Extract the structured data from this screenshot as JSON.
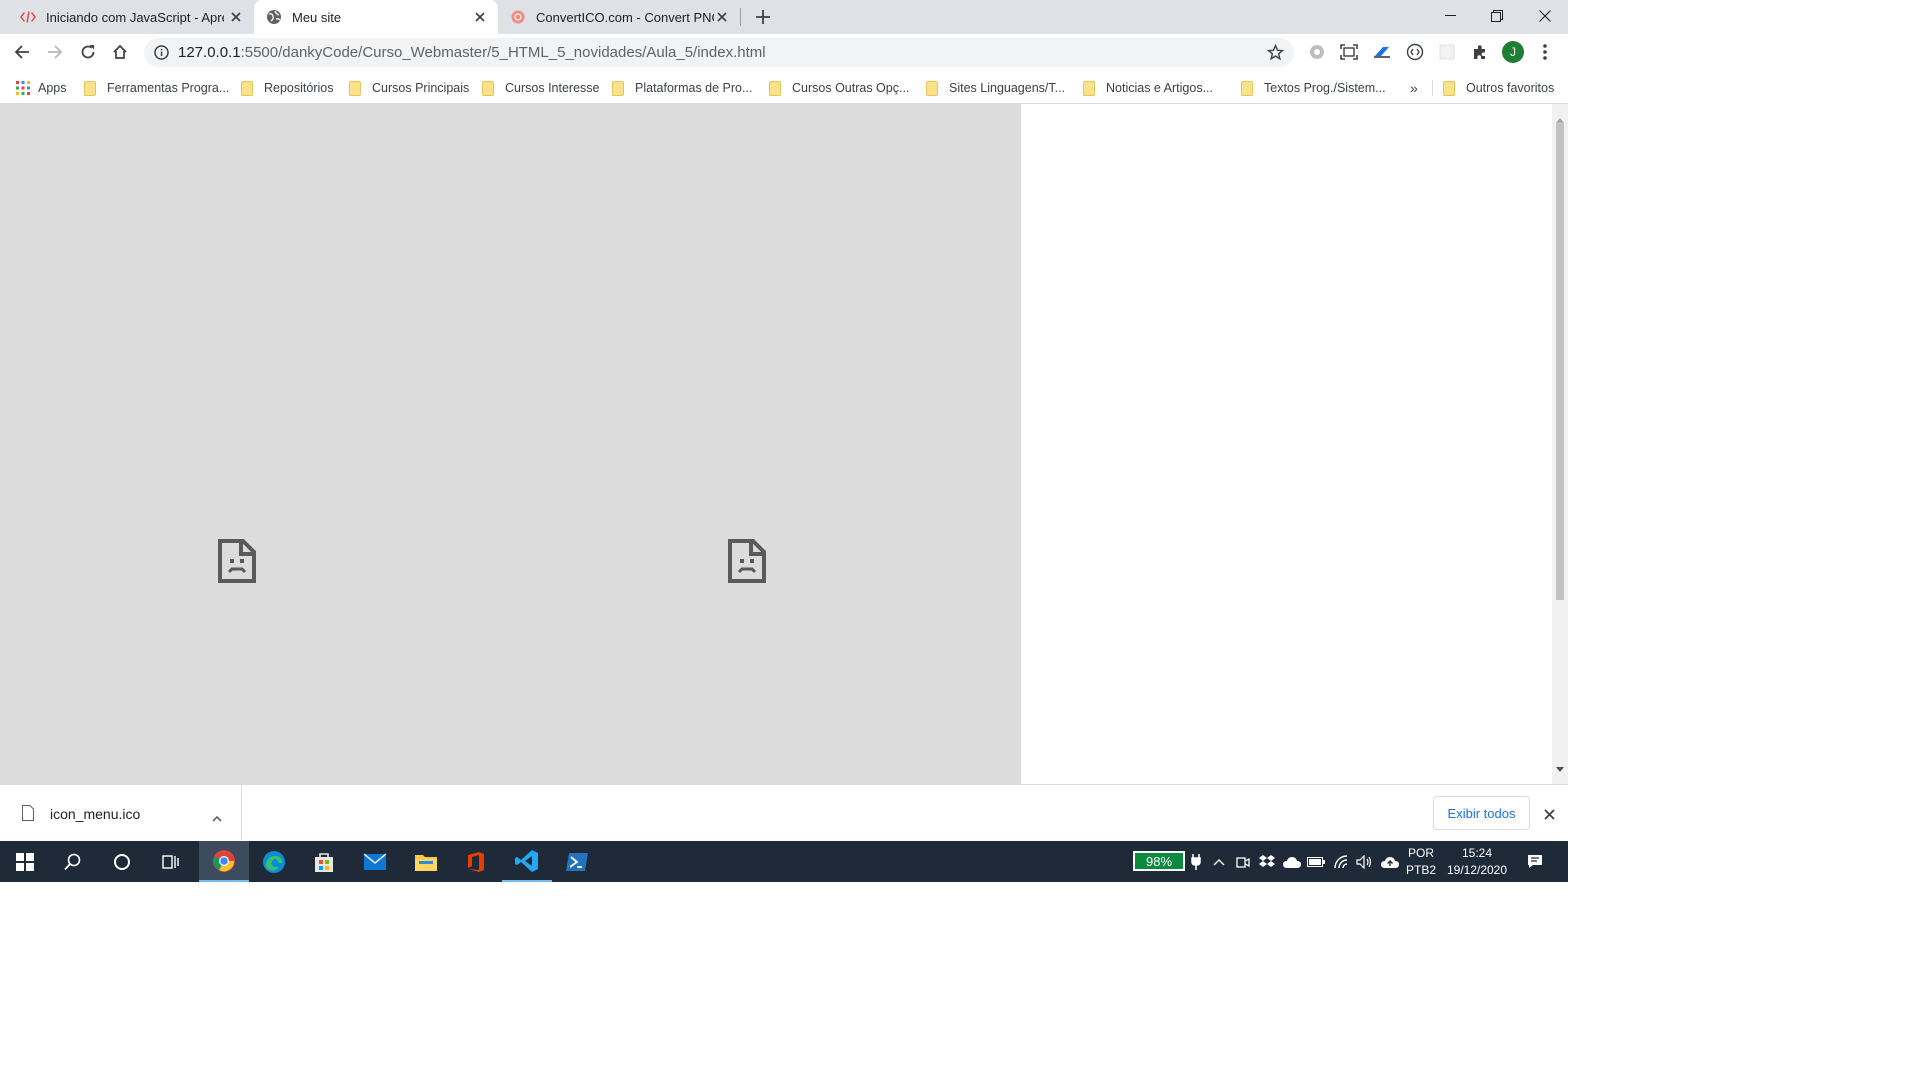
{
  "tabs": [
    {
      "title": "Iniciando com JavaScript - Apres",
      "active": false
    },
    {
      "title": "Meu site",
      "active": true
    },
    {
      "title": "ConvertICO.com - Convert PNG t",
      "active": false
    }
  ],
  "address_bar": {
    "host": "127.0.0.1",
    "path": ":5500/dankyCode/Curso_Webmaster/5_HTML_5_novidades/Aula_5/index.html"
  },
  "profile_initial": "J",
  "bookmarks": {
    "apps_label": "Apps",
    "items": [
      "Ferramentas Progra...",
      "Repositórios",
      "Cursos Principais",
      "Cursos Interesse",
      "Plataformas de Pro...",
      "Cursos Outras Opç...",
      "Sites Linguagens/T...",
      "Noticias e Artigos...",
      "Textos Prog./Sistem..."
    ],
    "overflow_label": "»",
    "other_label": "Outros favoritos"
  },
  "download_shelf": {
    "file_name": "icon_menu.ico",
    "show_all_label": "Exibir todos"
  },
  "taskbar": {
    "battery": "98%",
    "lang_line1": "POR",
    "lang_line2": "PTB2",
    "time": "15:24",
    "date": "19/12/2020"
  },
  "colors": {
    "tabstrip": "#dee1e6",
    "page_panel": "#dcdcdc",
    "taskbar": "#1e2a38",
    "accent_blue": "#1a73e8",
    "profile_green": "#1e7e34"
  }
}
